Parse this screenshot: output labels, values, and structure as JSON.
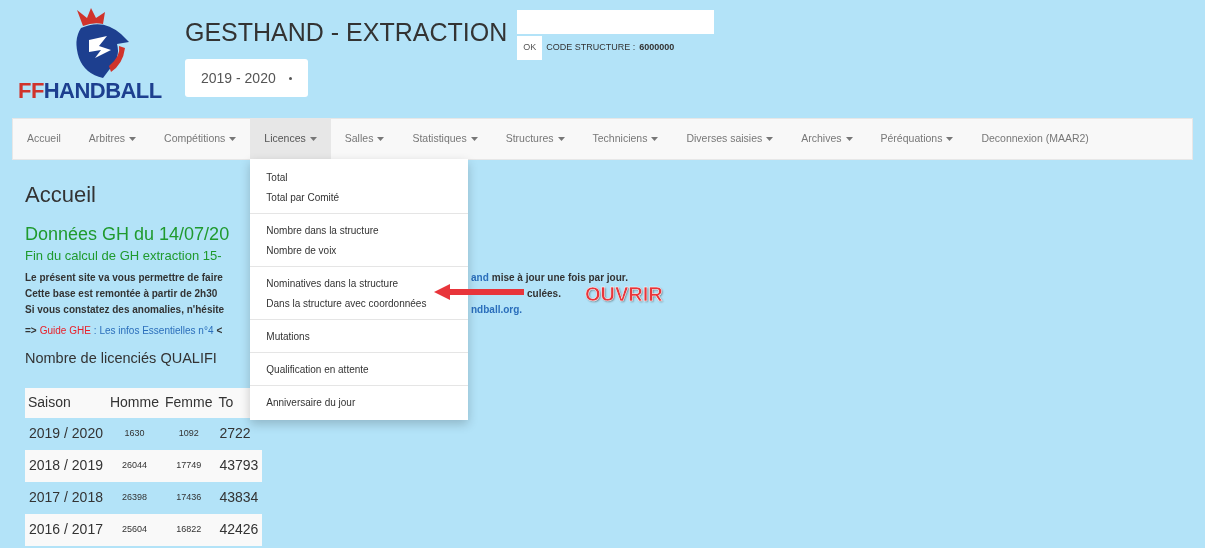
{
  "header": {
    "logo_prefix": "FF",
    "logo_name": "HANDBALL",
    "title": "GESTHAND - EXTRACTION",
    "season_select": {
      "value": "2019 - 2020"
    },
    "ok_button": "OK",
    "code_label": "CODE STRUCTURE :",
    "code_value": "6000000"
  },
  "nav": {
    "items": [
      {
        "label": "Accueil",
        "caret": false,
        "selected": false
      },
      {
        "label": "Arbitres",
        "caret": true,
        "selected": false
      },
      {
        "label": "Compétitions",
        "caret": true,
        "selected": false
      },
      {
        "label": "Licences",
        "caret": true,
        "selected": true
      },
      {
        "label": "Salles",
        "caret": true,
        "selected": false
      },
      {
        "label": "Statistiques",
        "caret": true,
        "selected": false
      },
      {
        "label": "Structures",
        "caret": true,
        "selected": false
      },
      {
        "label": "Techniciens",
        "caret": true,
        "selected": false
      },
      {
        "label": "Diverses saisies",
        "caret": true,
        "selected": false
      },
      {
        "label": "Archives",
        "caret": true,
        "selected": false
      },
      {
        "label": "Péréquations",
        "caret": true,
        "selected": false
      },
      {
        "label": "Deconnexion (MAAR2)",
        "caret": false,
        "selected": false
      }
    ]
  },
  "dropdown": {
    "groups": [
      [
        "Total",
        "Total par Comité"
      ],
      [
        "Nombre dans la structure",
        "Nombre de voix"
      ],
      [
        "Nominatives dans la structure",
        "Dans la structure avec coordonnées"
      ],
      [
        "Mutations"
      ],
      [
        "Qualification en attente"
      ],
      [
        "Anniversaire du jour"
      ]
    ]
  },
  "content": {
    "heading": "Accueil",
    "data_title": "Données GH du 14/07/20",
    "data_subtitle": "Fin du calcul de GH extraction 15-",
    "paragraph_rows": [
      {
        "left": "Le présent site va vous permettre de faire",
        "right_link": "and",
        "right_text": "mise à jour une fois par jour."
      },
      {
        "left": "Cette base est remontée à partir de 2h30",
        "right_text": "culées."
      },
      {
        "left": "Si vous constatez des anomalies, n'hésite",
        "right_link": "ndball.org."
      }
    ],
    "guide": {
      "prefix": "=>",
      "link": "Guide GHE",
      "rest": ": Les infos Essentielles n°4",
      "suffix": "<"
    },
    "subheading": "Nombre de licenciés QUALIFI",
    "table": {
      "columns": [
        "Saison",
        "Homme",
        "Femme",
        "To"
      ],
      "rows": [
        [
          "2019 / 2020",
          "1630",
          "1092",
          "2722"
        ],
        [
          "2018 / 2019",
          "26044",
          "17749",
          "43793"
        ],
        [
          "2017 / 2018",
          "26398",
          "17436",
          "43834"
        ],
        [
          "2016 / 2017",
          "25604",
          "16822",
          "42426"
        ]
      ]
    }
  },
  "annotation": {
    "label": "OUVRIR"
  }
}
